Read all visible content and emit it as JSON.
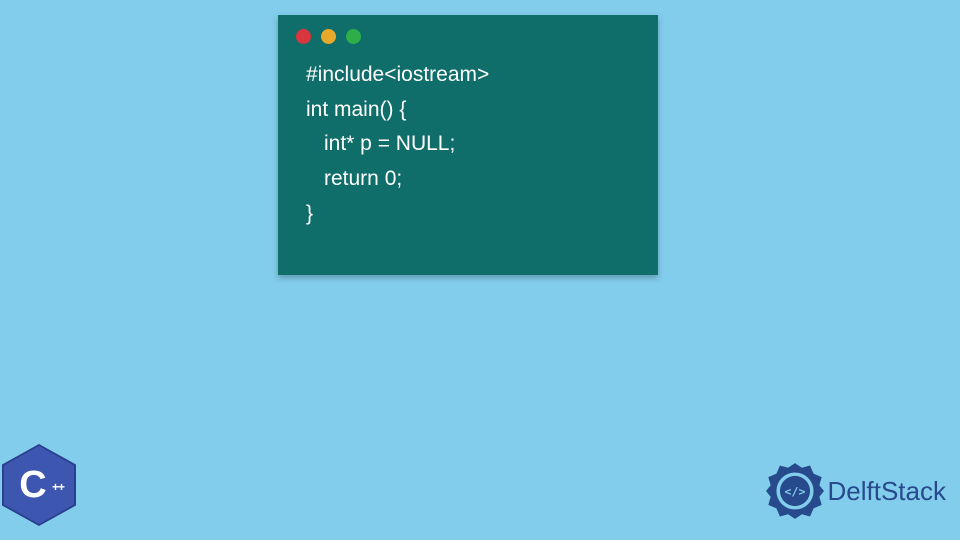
{
  "code": {
    "line1": "#include<iostream>",
    "line2": "int main() {",
    "line3": "int* p = NULL;",
    "line4": "return 0;",
    "line5": "}"
  },
  "cpp_logo": {
    "letter": "C",
    "suffix": "++"
  },
  "delft": {
    "brand": "DelftStack",
    "icon_glyph": "</>"
  },
  "colors": {
    "background": "#82cdec",
    "window": "#0f6e6a",
    "red": "#d9363e",
    "yellow": "#e6a92b",
    "green": "#2eae49",
    "cpp_hex": "#3d56b0",
    "delft_blue": "#274a8d"
  }
}
